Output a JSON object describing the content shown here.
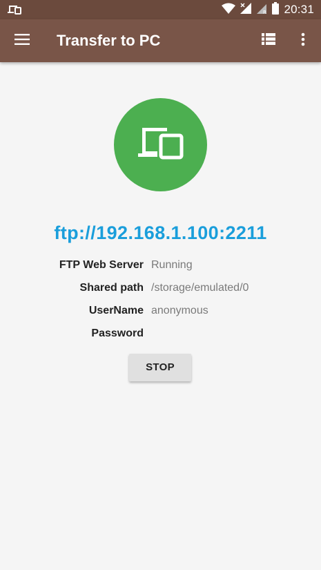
{
  "status_bar": {
    "time": "20:31",
    "left_icon": "devices-icon",
    "right_icons": [
      "wifi-icon",
      "signal-icon",
      "signal-roaming-icon",
      "battery-icon"
    ]
  },
  "app_bar": {
    "title": "Transfer to PC",
    "color": "#795548",
    "icons": [
      "menu-icon",
      "list-view-icon",
      "more-vert-icon"
    ]
  },
  "hero": {
    "icon": "devices-icon",
    "color": "#4caf50"
  },
  "server": {
    "url": "ftp://192.168.1.100:2211",
    "url_color": "#1a9edb",
    "rows": [
      {
        "label": "FTP Web Server",
        "value": "Running"
      },
      {
        "label": "Shared path",
        "value": "/storage/emulated/0"
      },
      {
        "label": "UserName",
        "value": "anonymous"
      },
      {
        "label": "Password",
        "value": ""
      }
    ]
  },
  "actions": {
    "stop_label": "STOP"
  }
}
